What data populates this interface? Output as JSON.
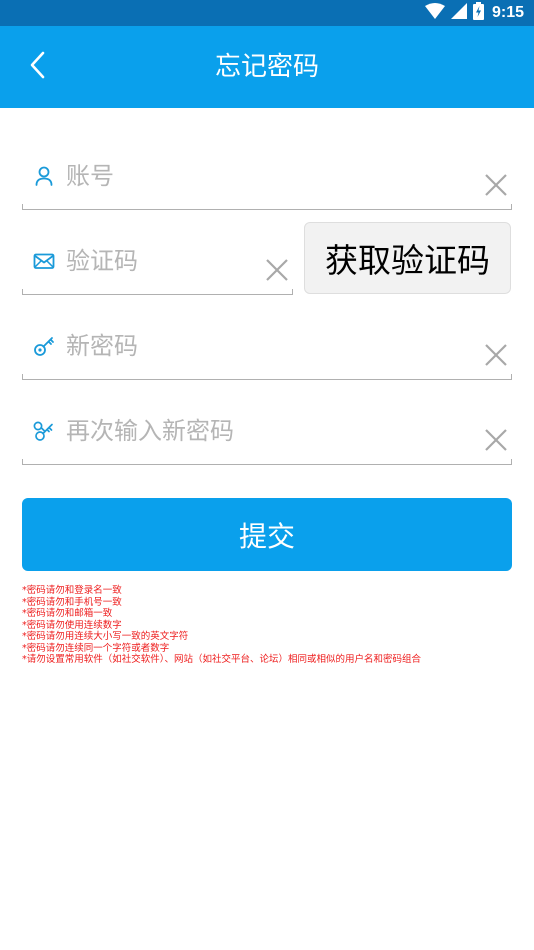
{
  "status_bar": {
    "time": "9:15",
    "icons": [
      "wifi-icon",
      "signal-icon",
      "battery-icon"
    ]
  },
  "app_bar": {
    "title": "忘记密码",
    "back_icon": "chevron-left-icon"
  },
  "form": {
    "account": {
      "placeholder": "账号",
      "value": "",
      "icon": "user-icon"
    },
    "code": {
      "placeholder": "验证码",
      "value": "",
      "icon": "mail-icon"
    },
    "get_code_label": "获取验证码",
    "new_password": {
      "placeholder": "新密码",
      "value": "",
      "icon": "key-icon"
    },
    "confirm_password": {
      "placeholder": "再次输入新密码",
      "value": "",
      "icon": "keys-icon"
    },
    "submit_label": "提交"
  },
  "rules": [
    "*密码请勿和登录名一致",
    "*密码请勿和手机号一致",
    "*密码请勿和邮箱一致",
    "*密码请勿使用连续数字",
    "*密码请勿用连续大小写一致的英文字符",
    "*密码请勿连续同一个字符或者数字",
    "*请勿设置常用软件（如社交软件）、网站（如社交平台、论坛）相同或相似的用户名和密码组合"
  ],
  "colors": {
    "status_bar": "#0a6fb4",
    "app_bar": "#0aa0ec",
    "accent": "#0aa0ec",
    "warning_text": "#ee1c1c",
    "placeholder": "#b5b5b5"
  }
}
